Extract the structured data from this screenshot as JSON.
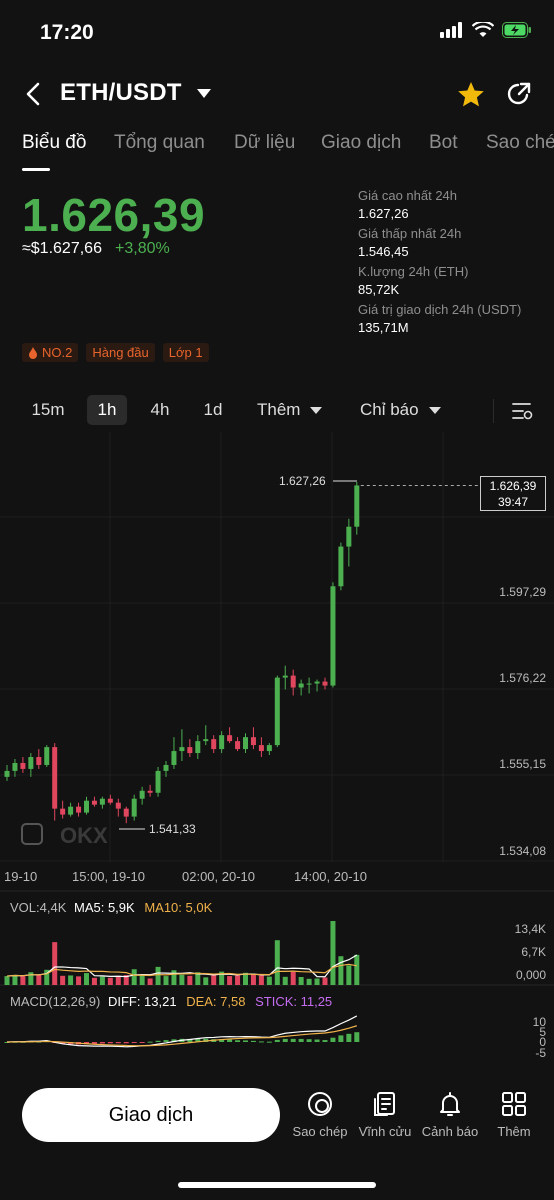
{
  "status": {
    "time": "17:20"
  },
  "nav": {
    "pair": "ETH/USDT"
  },
  "tabs": [
    "Biểu đồ",
    "Tổng quan",
    "Dữ liệu",
    "Giao dịch",
    "Bot",
    "Sao chép"
  ],
  "ticker": {
    "last": "1.626,39",
    "usd": "≈$1.627,66",
    "change": "+3,80%",
    "high_label": "Giá cao nhất 24h",
    "high": "1.627,26",
    "low_label": "Giá thấp nhất 24h",
    "low": "1.546,45",
    "vol_label": "K.lượng 24h (ETH)",
    "vol": "85,72K",
    "value_label": "Giá trị giao dịch 24h (USDT)",
    "value": "135,71M"
  },
  "badges": [
    "NO.2",
    "Hàng đầu",
    "Lớp 1"
  ],
  "timeframes": {
    "items": [
      "15m",
      "1h",
      "4h",
      "1d"
    ],
    "selected": "1h",
    "more": "Thêm",
    "indicators": "Chỉ báo"
  },
  "chart": {
    "price_axis": [
      "1.597,29",
      "1.576,22",
      "1.555,15",
      "1.534,08"
    ],
    "last_box_price": "1.626,39",
    "last_box_timer": "39:47",
    "high_marker": "1.627,26",
    "low_marker": "1.541,33",
    "time_axis": [
      "19-10",
      "15:00, 19-10",
      "02:00, 20-10",
      "14:00, 20-10"
    ],
    "vol": {
      "label": "VOL:4,4K",
      "ma5": "MA5: 5,9K",
      "ma10": "MA10: 5,0K",
      "axis": [
        "13,4K",
        "6,7K",
        "0,000"
      ]
    },
    "macd": {
      "label": "MACD(12,26,9)",
      "diff": "DIFF: 13,21",
      "dea": "DEA: 7,58",
      "stick": "STICK: 11,25",
      "axis": [
        "10",
        "5",
        "0",
        "-5"
      ]
    }
  },
  "chart_data": {
    "type": "candlestick",
    "ylim": [
      1534.08,
      1627.26
    ],
    "candles": [
      [
        1553.0,
        1556.0,
        1552.0,
        1554.5
      ],
      [
        1554.5,
        1557.5,
        1553.0,
        1556.5
      ],
      [
        1556.5,
        1558.0,
        1554.0,
        1555.0
      ],
      [
        1555.0,
        1559.0,
        1553.0,
        1558.0
      ],
      [
        1558.0,
        1560.0,
        1555.0,
        1556.0
      ],
      [
        1556.0,
        1561.0,
        1555.5,
        1560.5
      ],
      [
        1560.5,
        1561.5,
        1542.0,
        1545.0
      ],
      [
        1545.0,
        1547.0,
        1542.5,
        1543.5
      ],
      [
        1543.5,
        1546.5,
        1543.0,
        1545.5
      ],
      [
        1545.5,
        1546.5,
        1543.0,
        1544.0
      ],
      [
        1544.0,
        1548.0,
        1543.5,
        1547.0
      ],
      [
        1547.0,
        1548.0,
        1545.5,
        1546.0
      ],
      [
        1546.0,
        1548.0,
        1545.0,
        1547.5
      ],
      [
        1547.5,
        1548.5,
        1546.0,
        1546.5
      ],
      [
        1546.5,
        1547.5,
        1543.0,
        1545.0
      ],
      [
        1545.0,
        1545.5,
        1541.33,
        1543.0
      ],
      [
        1543.0,
        1548.5,
        1542.0,
        1547.5
      ],
      [
        1547.5,
        1550.5,
        1546.0,
        1549.5
      ],
      [
        1549.5,
        1551.0,
        1548.0,
        1549.0
      ],
      [
        1549.0,
        1555.5,
        1548.0,
        1554.5
      ],
      [
        1554.5,
        1557.0,
        1553.0,
        1556.0
      ],
      [
        1556.0,
        1563.0,
        1555.0,
        1559.5
      ],
      [
        1559.5,
        1565.0,
        1557.0,
        1560.5
      ],
      [
        1560.5,
        1562.5,
        1558.0,
        1559.0
      ],
      [
        1559.0,
        1563.5,
        1557.5,
        1562.0
      ],
      [
        1562.0,
        1566.0,
        1561.0,
        1562.5
      ],
      [
        1562.5,
        1563.5,
        1559.0,
        1560.0
      ],
      [
        1560.0,
        1564.5,
        1559.0,
        1563.5
      ],
      [
        1563.5,
        1565.5,
        1561.5,
        1562.0
      ],
      [
        1562.0,
        1563.0,
        1559.5,
        1560.0
      ],
      [
        1560.0,
        1564.0,
        1559.0,
        1563.0
      ],
      [
        1563.0,
        1565.5,
        1560.0,
        1561.0
      ],
      [
        1561.0,
        1563.0,
        1558.0,
        1559.5
      ],
      [
        1559.5,
        1561.5,
        1558.5,
        1561.0
      ],
      [
        1561.0,
        1578.5,
        1560.5,
        1578.0
      ],
      [
        1578.0,
        1581.0,
        1575.0,
        1578.5
      ],
      [
        1578.5,
        1580.0,
        1573.5,
        1575.5
      ],
      [
        1575.5,
        1577.5,
        1573.5,
        1576.5
      ],
      [
        1576.5,
        1578.0,
        1574.0,
        1576.5
      ],
      [
        1576.5,
        1577.5,
        1574.5,
        1577.0
      ],
      [
        1577.0,
        1578.0,
        1575.0,
        1576.0
      ],
      [
        1576.0,
        1602.0,
        1575.5,
        1601.0
      ],
      [
        1601.0,
        1612.0,
        1600.0,
        1611.0
      ],
      [
        1611.0,
        1618.0,
        1606.0,
        1616.0
      ],
      [
        1616.0,
        1627.26,
        1614.0,
        1626.39
      ]
    ]
  },
  "bottom": {
    "trade": "Giao dịch",
    "items": [
      {
        "label": "Sao chép",
        "icon": "copy-trade-icon"
      },
      {
        "label": "Vĩnh cửu",
        "icon": "perpetual-icon"
      },
      {
        "label": "Cảnh báo",
        "icon": "bell-icon"
      },
      {
        "label": "Thêm",
        "icon": "grid-icon"
      }
    ]
  },
  "colors": {
    "up": "#4caf50",
    "down": "#e0465e",
    "ma5": "#ffffff",
    "ma10": "#f0b24a",
    "stick": "#c66cf0"
  }
}
